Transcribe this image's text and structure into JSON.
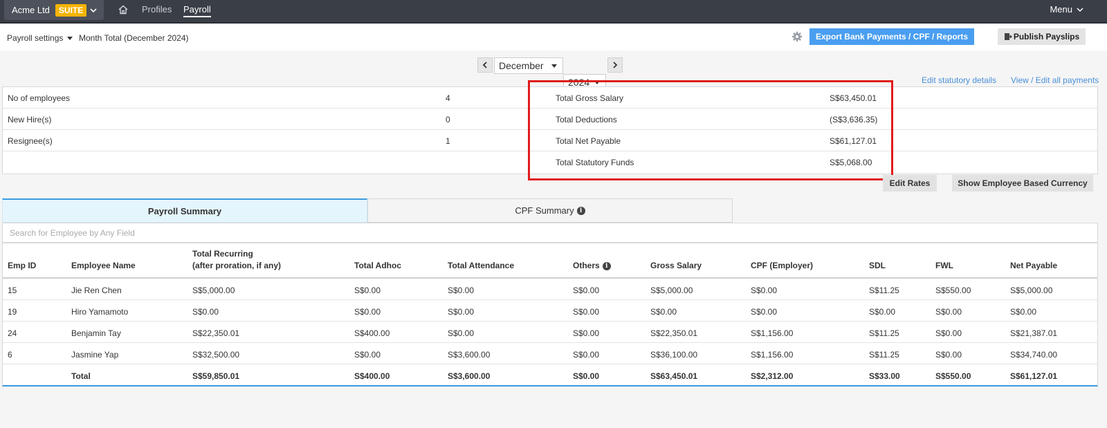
{
  "nav": {
    "company": "Acme Ltd",
    "suite": "SUITE",
    "links": [
      "Profiles",
      "Payroll"
    ],
    "menu": "Menu"
  },
  "subheader": {
    "payroll_settings": "Payroll settings",
    "month_total": "Month Total (December 2024)",
    "export_label": "Export Bank Payments / CPF / Reports",
    "publish_label": "Publish Payslips"
  },
  "picker": {
    "month": "December",
    "year": "2024"
  },
  "links": {
    "statutory": "Edit statutory details",
    "all_payments": "View / Edit all payments"
  },
  "stats": {
    "left": [
      {
        "label": "No of employees",
        "value": "4"
      },
      {
        "label": "New Hire(s)",
        "value": "0"
      },
      {
        "label": "Resignee(s)",
        "value": "1"
      }
    ],
    "right": [
      {
        "label": "Total Gross Salary",
        "value": "S$63,450.01"
      },
      {
        "label": "Total Deductions",
        "value": "(S$3,636.35)"
      },
      {
        "label": "Total Net Payable",
        "value": "S$61,127.01"
      },
      {
        "label": "Total Statutory Funds",
        "value": "S$5,068.00"
      }
    ]
  },
  "buttons": {
    "edit_rates": "Edit Rates",
    "show_currency": "Show Employee Based Currency"
  },
  "tabs": {
    "payroll_summary": "Payroll Summary",
    "cpf_summary": "CPF Summary"
  },
  "search": {
    "placeholder": "Search for Employee by Any Field"
  },
  "table": {
    "headers": {
      "emp_id": "Emp ID",
      "name": "Employee Name",
      "recurring_1": "Total Recurring",
      "recurring_2": "(after proration, if any)",
      "adhoc": "Total Adhoc",
      "attendance": "Total Attendance",
      "others": "Others",
      "gross": "Gross Salary",
      "cpf": "CPF (Employer)",
      "sdl": "SDL",
      "fwl": "FWL",
      "net": "Net Payable"
    },
    "rows": [
      [
        "15",
        "Jie Ren Chen",
        "S$5,000.00",
        "S$0.00",
        "S$0.00",
        "S$0.00",
        "S$5,000.00",
        "S$0.00",
        "S$11.25",
        "S$550.00",
        "S$5,000.00"
      ],
      [
        "19",
        "Hiro Yamamoto",
        "S$0.00",
        "S$0.00",
        "S$0.00",
        "S$0.00",
        "S$0.00",
        "S$0.00",
        "S$0.00",
        "S$0.00",
        "S$0.00"
      ],
      [
        "24",
        "Benjamin Tay",
        "S$22,350.01",
        "S$400.00",
        "S$0.00",
        "S$0.00",
        "S$22,350.01",
        "S$1,156.00",
        "S$11.25",
        "S$0.00",
        "S$21,387.01"
      ],
      [
        "6",
        "Jasmine Yap",
        "S$32,500.00",
        "S$0.00",
        "S$3,600.00",
        "S$0.00",
        "S$36,100.00",
        "S$1,156.00",
        "S$11.25",
        "S$0.00",
        "S$34,740.00"
      ]
    ],
    "total": [
      "",
      "Total",
      "S$59,850.01",
      "S$400.00",
      "S$3,600.00",
      "S$0.00",
      "S$63,450.01",
      "S$2,312.00",
      "S$33.00",
      "S$550.00",
      "S$61,127.01"
    ]
  },
  "colors": {
    "accent": "#4a9ef0",
    "highlight": "#e01b1b",
    "nav_bg": "#3a3e47",
    "suite_badge": "#f6b400"
  }
}
